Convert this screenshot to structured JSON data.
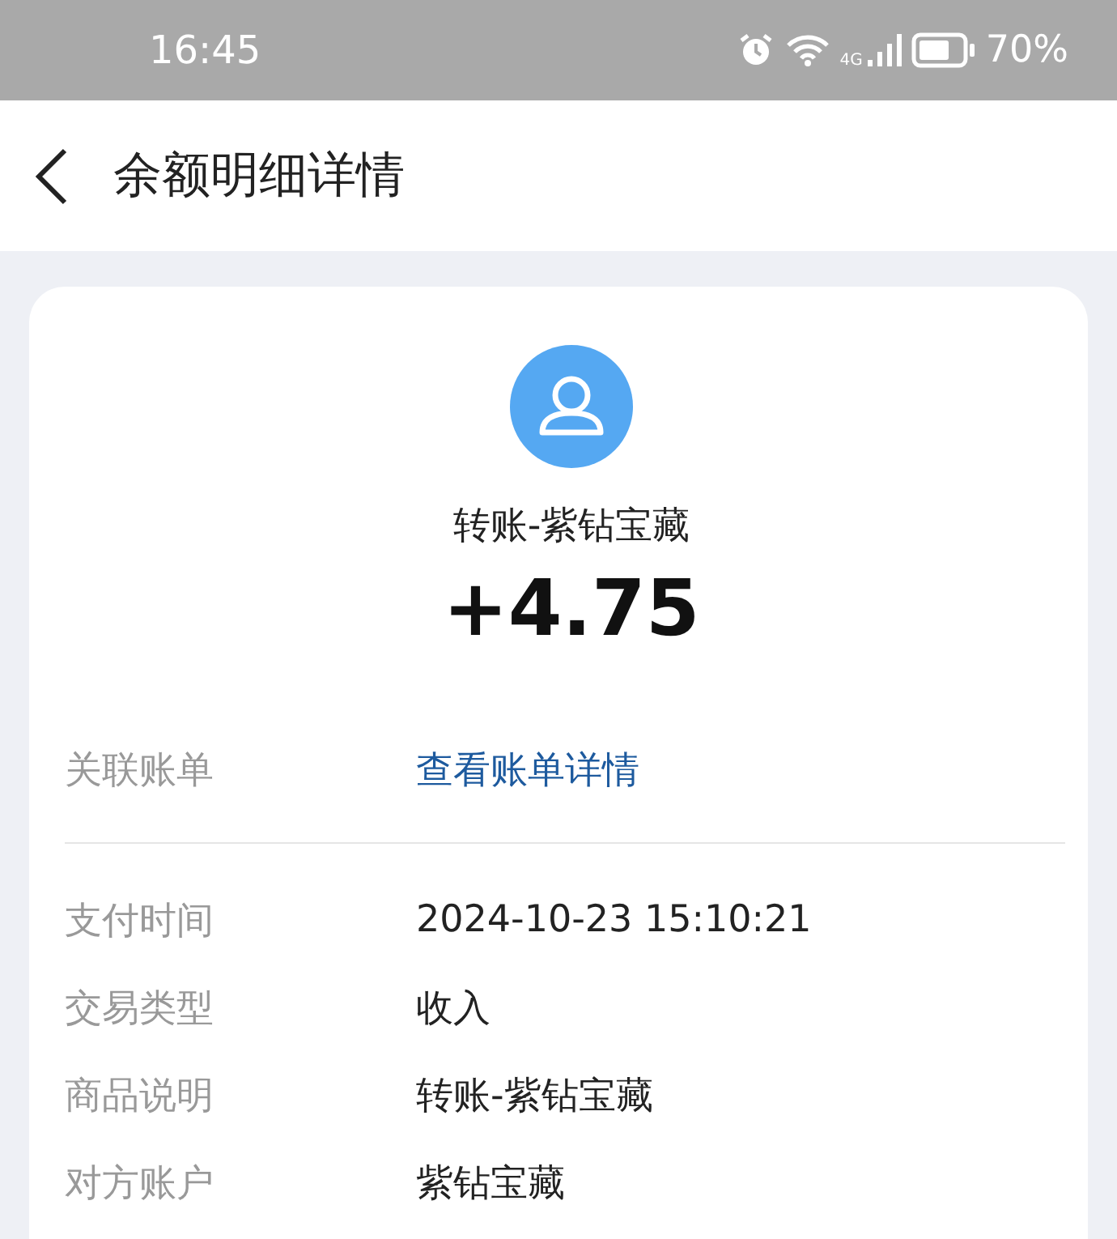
{
  "status_bar": {
    "time": "16:45",
    "network": "4G",
    "battery": "70%"
  },
  "header": {
    "title": "余额明细详情"
  },
  "card": {
    "name": "转账-紫钻宝藏",
    "amount": "+4.75",
    "link_row": {
      "label": "关联账单",
      "link": "查看账单详情"
    },
    "rows": [
      {
        "label": "支付时间",
        "value": "2024-10-23 15:10:21"
      },
      {
        "label": "交易类型",
        "value": "收入"
      },
      {
        "label": "商品说明",
        "value": "转账-紫钻宝藏"
      },
      {
        "label": "对方账户",
        "value": "紫钻宝藏"
      }
    ]
  }
}
